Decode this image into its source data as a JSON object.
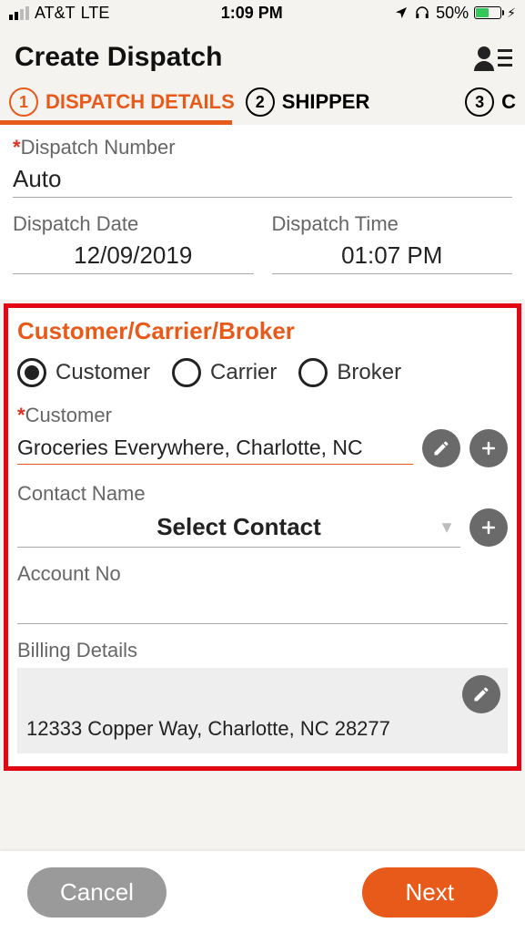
{
  "status": {
    "carrier": "AT&T",
    "network": "LTE",
    "time": "1:09 PM",
    "battery_pct": "50%"
  },
  "header": {
    "title": "Create Dispatch"
  },
  "stepper": {
    "steps": [
      {
        "num": "1",
        "label": "DISPATCH DETAILS"
      },
      {
        "num": "2",
        "label": "SHIPPER"
      },
      {
        "num": "3",
        "label": "C"
      }
    ]
  },
  "form": {
    "dispatch_number_label": "Dispatch Number",
    "dispatch_number_value": "Auto",
    "dispatch_date_label": "Dispatch Date",
    "dispatch_date_value": "12/09/2019",
    "dispatch_time_label": "Dispatch Time",
    "dispatch_time_value": "01:07 PM"
  },
  "group": {
    "title": "Customer/Carrier/Broker",
    "radios": [
      {
        "label": "Customer",
        "selected": true
      },
      {
        "label": "Carrier",
        "selected": false
      },
      {
        "label": "Broker",
        "selected": false
      }
    ],
    "customer_label": "Customer",
    "customer_value": "Groceries Everywhere, Charlotte, NC",
    "contact_label": "Contact Name",
    "contact_placeholder": "Select Contact",
    "account_label": "Account No",
    "account_value": "",
    "billing_label": "Billing Details",
    "billing_address": "12333 Copper Way, Charlotte, NC 28277"
  },
  "buttons": {
    "cancel": "Cancel",
    "next": "Next"
  }
}
